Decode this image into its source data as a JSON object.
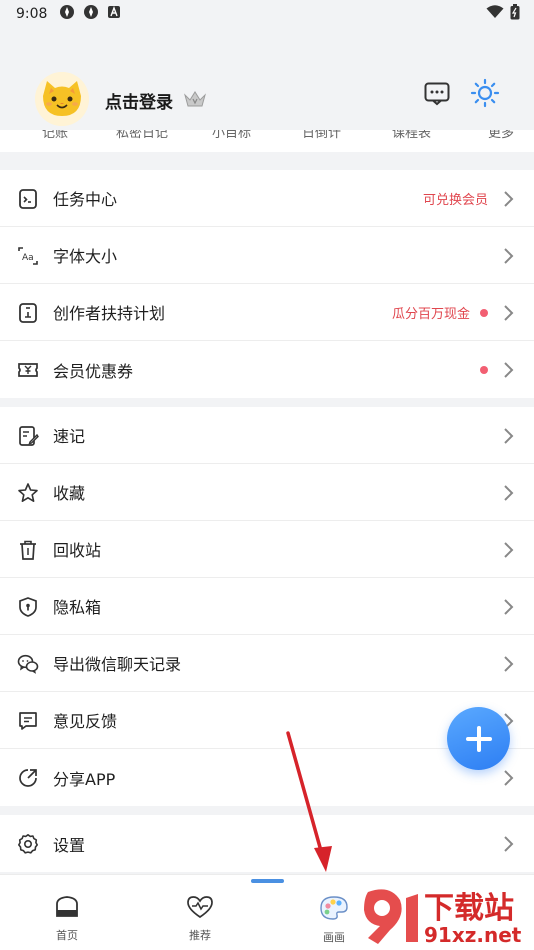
{
  "status_bar": {
    "time": "9:08"
  },
  "profile": {
    "login_label": "点击登录"
  },
  "shortcut_strip": {
    "labels": [
      "记账",
      "私密日记",
      "小目标",
      "日倒计",
      "课程表",
      "更多"
    ]
  },
  "group1": [
    {
      "label": "任务中心",
      "icon": "task-icon",
      "tag": "可兑换会员",
      "dot": false
    },
    {
      "label": "字体大小",
      "icon": "font-size-icon",
      "tag": "",
      "dot": false
    },
    {
      "label": "创作者扶持计划",
      "icon": "creator-icon",
      "tag": "瓜分百万现金",
      "dot": true
    },
    {
      "label": "会员优惠券",
      "icon": "coupon-icon",
      "tag": "",
      "dot": true
    }
  ],
  "group2": [
    {
      "label": "速记",
      "icon": "quick-note-icon"
    },
    {
      "label": "收藏",
      "icon": "star-icon"
    },
    {
      "label": "回收站",
      "icon": "trash-icon"
    },
    {
      "label": "隐私箱",
      "icon": "shield-icon"
    },
    {
      "label": "导出微信聊天记录",
      "icon": "wechat-icon"
    },
    {
      "label": "意见反馈",
      "icon": "feedback-icon"
    },
    {
      "label": "分享APP",
      "icon": "share-icon"
    }
  ],
  "group3": [
    {
      "label": "设置",
      "icon": "gear-icon"
    }
  ],
  "tabbar": {
    "tabs": [
      {
        "label": "首页",
        "icon": "home-icon"
      },
      {
        "label": "推荐",
        "icon": "heart-icon"
      },
      {
        "label": "画画",
        "icon": "palette-icon"
      }
    ]
  },
  "watermark": {
    "text": "9下载站 91xz.net"
  },
  "colors": {
    "accent": "#4a90e2",
    "tag_red": "#e0464e",
    "fab_blue": "#2d7ef3",
    "arrow_red": "#d6232a"
  }
}
